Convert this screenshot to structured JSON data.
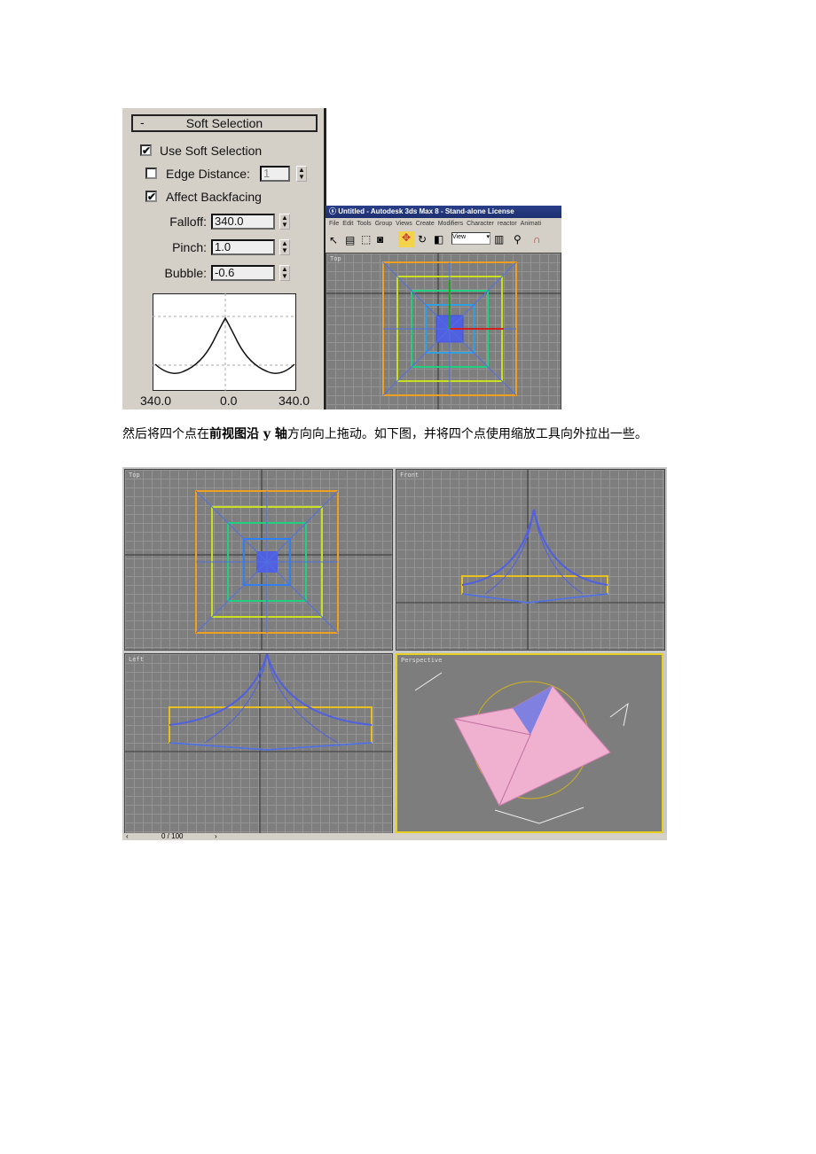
{
  "soft_selection": {
    "title": "Soft Selection",
    "collapse": "-",
    "use_soft_selection": {
      "label": "Use Soft Selection",
      "checked": true
    },
    "edge_distance": {
      "label": "Edge Distance:",
      "checked": false,
      "value": "1"
    },
    "affect_backfacing": {
      "label": "Affect Backfacing",
      "checked": true
    },
    "falloff": {
      "label": "Falloff:",
      "value": "340.0"
    },
    "pinch": {
      "label": "Pinch:",
      "value": "1.0"
    },
    "bubble": {
      "label": "Bubble:",
      "value": "-0.6"
    },
    "curve_labels": [
      "340.0",
      "0.0",
      "340.0"
    ]
  },
  "max_window": {
    "title": "Untitled - Autodesk 3ds Max 8  - Stand-alone License",
    "menu": [
      "File",
      "Edit",
      "Tools",
      "Group",
      "Views",
      "Create",
      "Modifiers",
      "Character",
      "reactor",
      "Animati"
    ],
    "view_dropdown": "View",
    "viewport_label": "Top"
  },
  "paragraph": {
    "part1": "然后将四个点在",
    "bold1": "前视图沿 y 轴",
    "part2": "方向向上拖动。如下图，并将四个点使用缩放工具向外拉出一些。"
  },
  "viewports": {
    "top": "Top",
    "front": "Front",
    "left": "Left",
    "perspective": "Perspective",
    "timeline": "0 / 100",
    "active_color": "#e8d020"
  }
}
